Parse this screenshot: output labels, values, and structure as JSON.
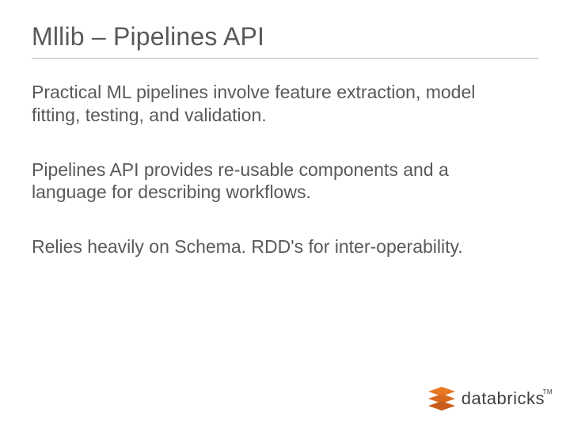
{
  "slide": {
    "title": "Mllib – Pipelines API",
    "paragraphs": [
      "Practical ML pipelines involve feature extraction, model fitting, testing, and validation.",
      "Pipelines API provides re-usable components and a language for describing workflows.",
      "Relies heavily on Schema. RDD's for inter-operability."
    ]
  },
  "logo": {
    "text": "databricks",
    "tm": "TM"
  }
}
